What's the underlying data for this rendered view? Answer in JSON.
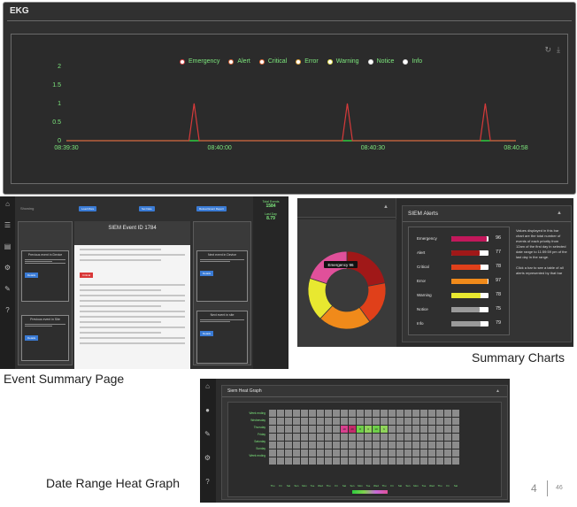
{
  "ekg": {
    "title": "EKG",
    "legend": [
      "Emergency",
      "Alert",
      "Critical",
      "Error",
      "Warning",
      "Notice",
      "Info"
    ],
    "legend_colors": [
      "#d64545",
      "#d6663a",
      "#e06c3a",
      "#e0a53a",
      "#e6e04a",
      "#dddddd",
      "#dddddd"
    ],
    "tools": [
      "↻",
      "⤓"
    ]
  },
  "chart_data": {
    "type": "line",
    "title": "",
    "xlabel": "",
    "ylabel": "",
    "y_ticks": [
      "0",
      "0.5",
      "1",
      "1.5",
      "2"
    ],
    "ylim": [
      0,
      2
    ],
    "x_ticks": [
      "08:39:30",
      "08:40:00",
      "08:40:30",
      "08:40:58"
    ],
    "x": [
      "08:39:30",
      "08:39:54",
      "08:39:55",
      "08:39:56",
      "08:40:24",
      "08:40:25",
      "08:40:26",
      "08:40:51",
      "08:40:52",
      "08:40:53",
      "08:40:58"
    ],
    "series": [
      {
        "values": [
          0,
          0,
          1,
          0,
          0,
          1,
          0,
          0,
          1,
          0,
          0
        ],
        "color": "#d63a3a"
      }
    ],
    "grid": false,
    "legend_position": "top"
  },
  "event_page": {
    "topbar_text": "Showing",
    "buttons": [
      "Load More",
      "Set Date",
      "Reload Event Report"
    ],
    "center_title": "SIEM Event ID 1784",
    "center_badge": "Critical",
    "left_boxes": [
      "Previous event in Device",
      "Previous event in Site"
    ],
    "right_boxes": [
      "Next event in Device",
      "Next event in site"
    ],
    "box_button": "Details",
    "stats": [
      {
        "label": "Total Events",
        "value": "1584"
      },
      {
        "label": "Last Day",
        "value": "8.79"
      }
    ],
    "side_icons": [
      "⌂",
      "☰",
      "▤",
      "⚙",
      "✎",
      "?"
    ]
  },
  "summary": {
    "panel_title": "SIEM Alerts",
    "donut_label": "Emergency 96",
    "rows": [
      {
        "label": "Emergency",
        "value": "96",
        "pct": 96,
        "color": "#c2185b"
      },
      {
        "label": "Alert",
        "value": "77",
        "pct": 77,
        "color": "#a01818"
      },
      {
        "label": "Critical",
        "value": "78",
        "pct": 78,
        "color": "#e0401a"
      },
      {
        "label": "Error",
        "value": "97",
        "pct": 97,
        "color": "#f08a1a"
      },
      {
        "label": "Warning",
        "value": "78",
        "pct": 78,
        "color": "#e8e830"
      },
      {
        "label": "Notice",
        "value": "75",
        "pct": 75,
        "color": "#9a9a9a"
      },
      {
        "label": "Info",
        "value": "79",
        "pct": 79,
        "color": "#9a9a9a"
      }
    ],
    "desc": [
      "Values displayed in this bar chart are the total number of events of each priority from 12am of the first day in selected date range to 11:59:59 pm of the last day in the range.",
      "Click a bar to see a table of all alerts represented by that bar"
    ],
    "donut": [
      {
        "pct": 22,
        "color": "#a01818"
      },
      {
        "pct": 18,
        "color": "#e0401a"
      },
      {
        "pct": 22,
        "color": "#f08a1a"
      },
      {
        "pct": 18,
        "color": "#e8e830"
      },
      {
        "pct": 20,
        "color": "#e0509a"
      }
    ]
  },
  "heat": {
    "title": "Siem Heat Graph",
    "ylabels": [
      "Week ending",
      "Wednesday",
      "Thursday",
      "Friday",
      "Saturday",
      "Sunday",
      "Week ending"
    ],
    "xlabels": [
      "Thu",
      "Fri",
      "Sat",
      "Sun",
      "Mon",
      "Tue",
      "Wed",
      "Thu",
      "Fri",
      "Sat",
      "Sun",
      "Mon",
      "Tue",
      "Wed",
      "Thu",
      "Fri",
      "Sat",
      "Sun",
      "Mon",
      "Tue",
      "Wed",
      "Thu",
      "Fri",
      "Sat"
    ],
    "hot_cells": [
      {
        "row": 2,
        "col": 9,
        "color": "#d9408e",
        "text": "19"
      },
      {
        "row": 2,
        "col": 10,
        "color": "#c42a6a",
        "text": "49"
      },
      {
        "row": 2,
        "col": 11,
        "color": "#6fcf4a",
        "text": "8"
      },
      {
        "row": 2,
        "col": 12,
        "color": "#8fd45a",
        "text": "3"
      },
      {
        "row": 2,
        "col": 13,
        "color": "#6fcf4a",
        "text": "10"
      },
      {
        "row": 2,
        "col": 14,
        "color": "#8fd45a",
        "text": "6"
      }
    ],
    "side_icons": [
      "⌂",
      "●",
      "✎",
      "⚙",
      "?"
    ]
  },
  "captions": {
    "event": "Event Summary Page",
    "charts": "Summary Charts",
    "heat": "Date Range Heat Graph"
  },
  "slide": {
    "logo": "4",
    "number": "46"
  }
}
